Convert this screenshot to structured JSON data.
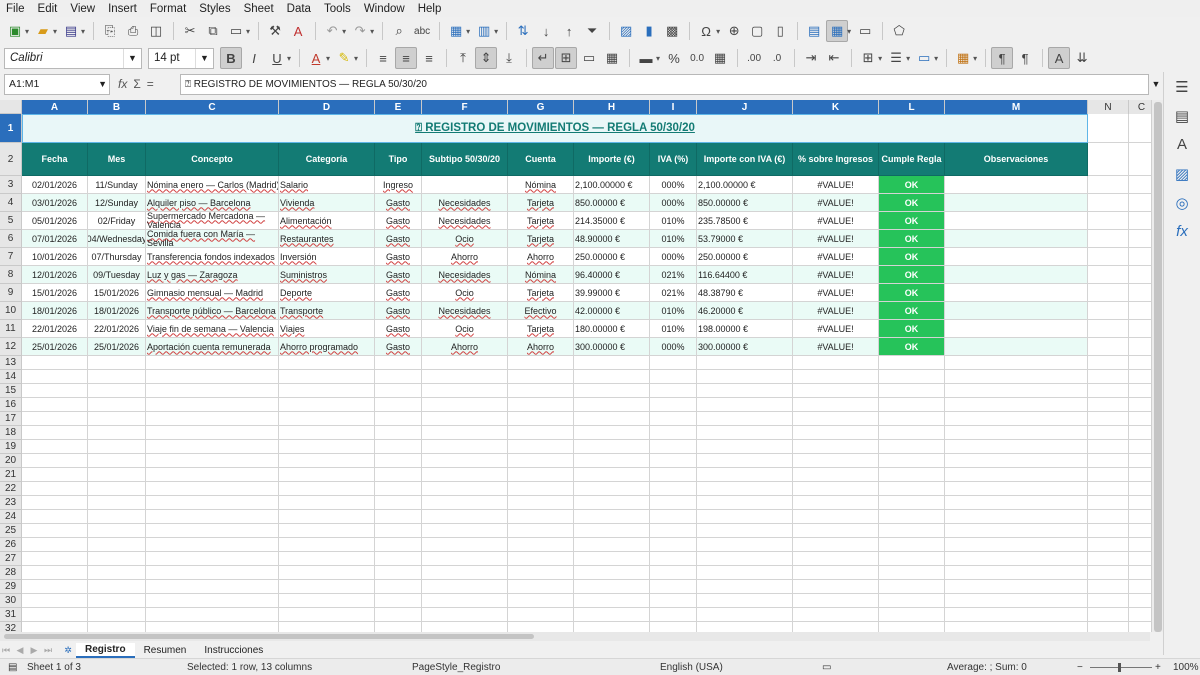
{
  "menu": [
    "File",
    "Edit",
    "View",
    "Insert",
    "Format",
    "Styles",
    "Sheet",
    "Data",
    "Tools",
    "Window",
    "Help"
  ],
  "font": {
    "name": "Calibri",
    "size": "14 pt"
  },
  "name_box": "A1:M1",
  "formula": "⍰ REGISTRO DE MOVIMIENTOS — REGLA 50/30/20",
  "columns": [
    {
      "letter": "A",
      "header": "Fecha"
    },
    {
      "letter": "B",
      "header": "Mes"
    },
    {
      "letter": "C",
      "header": "Concepto"
    },
    {
      "letter": "D",
      "header": "Categoría"
    },
    {
      "letter": "E",
      "header": "Tipo"
    },
    {
      "letter": "F",
      "header": "Subtipo 50/30/20"
    },
    {
      "letter": "G",
      "header": "Cuenta"
    },
    {
      "letter": "H",
      "header": "Importe (€)"
    },
    {
      "letter": "I",
      "header": "IVA (%)"
    },
    {
      "letter": "J",
      "header": "Importe con IVA (€)"
    },
    {
      "letter": "K",
      "header": "% sobre Ingresos"
    },
    {
      "letter": "L",
      "header": "Cumple Regla"
    },
    {
      "letter": "M",
      "header": "Observaciones"
    },
    {
      "letter": "N",
      "header": ""
    },
    {
      "letter": "C",
      "header": ""
    }
  ],
  "title": "⍰ REGISTRO DE MOVIMIENTOS — REGLA 50/30/20",
  "rows": [
    [
      "02/01/2026",
      "11/Sunday",
      "Nómina enero — Carlos (Madrid)",
      "Salario",
      "Ingreso",
      "",
      "Nómina",
      "2,100.00000 €",
      "000%",
      "2,100.00000 €",
      "#VALUE!",
      "OK",
      ""
    ],
    [
      "03/01/2026",
      "12/Sunday",
      "Alquiler piso — Barcelona",
      "Vivienda",
      "Gasto",
      "Necesidades",
      "Tarjeta",
      "850.00000 €",
      "000%",
      "850.00000 €",
      "#VALUE!",
      "OK",
      ""
    ],
    [
      "05/01/2026",
      "02/Friday",
      "Supermercado Mercadona — Valencia",
      "Alimentación",
      "Gasto",
      "Necesidades",
      "Tarjeta",
      "214.35000 €",
      "010%",
      "235.78500 €",
      "#VALUE!",
      "OK",
      ""
    ],
    [
      "07/01/2026",
      "04/Wednesday",
      "Comida fuera con María — Sevilla",
      "Restaurantes",
      "Gasto",
      "Ocio",
      "Tarjeta",
      "48.90000 €",
      "010%",
      "53.79000 €",
      "#VALUE!",
      "OK",
      ""
    ],
    [
      "10/01/2026",
      "07/Thursday",
      "Transferencia fondos indexados",
      "Inversión",
      "Gasto",
      "Ahorro",
      "Ahorro",
      "250.00000 €",
      "000%",
      "250.00000 €",
      "#VALUE!",
      "OK",
      ""
    ],
    [
      "12/01/2026",
      "09/Tuesday",
      "Luz y gas — Zaragoza",
      "Suministros",
      "Gasto",
      "Necesidades",
      "Nómina",
      "96.40000 €",
      "021%",
      "116.64400 €",
      "#VALUE!",
      "OK",
      ""
    ],
    [
      "15/01/2026",
      "15/01/2026",
      "Gimnasio mensual — Madrid",
      "Deporte",
      "Gasto",
      "Ocio",
      "Tarjeta",
      "39.99000 €",
      "021%",
      "48.38790 €",
      "#VALUE!",
      "OK",
      ""
    ],
    [
      "18/01/2026",
      "18/01/2026",
      "Transporte público — Barcelona",
      "Transporte",
      "Gasto",
      "Necesidades",
      "Efectivo",
      "42.00000 €",
      "010%",
      "46.20000 €",
      "#VALUE!",
      "OK",
      ""
    ],
    [
      "22/01/2026",
      "22/01/2026",
      "Viaje fin de semana — Valencia",
      "Viajes",
      "Gasto",
      "Ocio",
      "Tarjeta",
      "180.00000 €",
      "010%",
      "198.00000 €",
      "#VALUE!",
      "OK",
      ""
    ],
    [
      "25/01/2026",
      "25/01/2026",
      "Aportación cuenta remunerada",
      "Ahorro programado",
      "Gasto",
      "Ahorro",
      "Ahorro",
      "300.00000 €",
      "000%",
      "300.00000 €",
      "#VALUE!",
      "OK",
      ""
    ]
  ],
  "row_numbers": [
    "1",
    "2",
    "3",
    "4",
    "5",
    "6",
    "7",
    "8",
    "9",
    "10",
    "11",
    "12",
    "13",
    "14",
    "15",
    "16",
    "17",
    "18",
    "19",
    "20",
    "21",
    "22",
    "23",
    "24",
    "25",
    "26",
    "27",
    "28",
    "29",
    "30",
    "31",
    "32"
  ],
  "tabs": [
    "Registro",
    "Resumen",
    "Instrucciones"
  ],
  "active_tab": "Registro",
  "status": {
    "sheet": "Sheet 1 of 3",
    "selection": "Selected: 1 row, 13 columns",
    "page_style": "PageStyle_Registro",
    "language": "English (USA)",
    "summary": "Average: ; Sum: 0",
    "zoom": "100%"
  },
  "colors": {
    "header_teal": "#137b74",
    "ok_green": "#26c35a",
    "selection_blue": "#2a6ebc",
    "stripe": "#eafbf6"
  }
}
